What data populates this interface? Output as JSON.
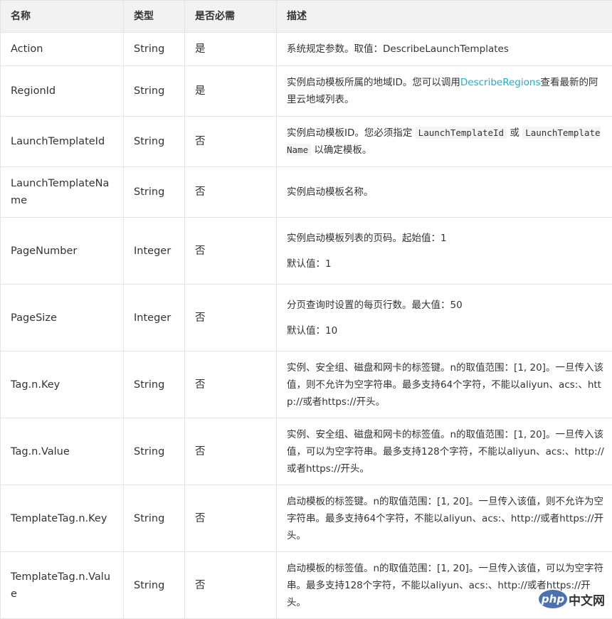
{
  "table": {
    "headers": [
      "名称",
      "类型",
      "是否必需",
      "描述"
    ],
    "rows": [
      {
        "name": "Action",
        "type": "String",
        "required": "是",
        "desc": "系统规定参数。取值：DescribeLaunchTemplates"
      },
      {
        "name": "RegionId",
        "type": "String",
        "required": "是",
        "desc_pre": "实例启动模板所属的地域ID。您可以调用",
        "desc_link": "DescribeRegions",
        "desc_post": "查看最新的阿里云地域列表。"
      },
      {
        "name": "LaunchTemplateId",
        "type": "String",
        "required": "否",
        "desc_pre": "实例启动模板ID。您必须指定 ",
        "code1": "LaunchTemplateId",
        "desc_mid": " 或 ",
        "code2": "LaunchTemplateName",
        "desc_post": " 以确定模板。"
      },
      {
        "name": "LaunchTemplateName",
        "type": "String",
        "required": "否",
        "desc": "实例启动模板名称。"
      },
      {
        "name": "PageNumber",
        "type": "Integer",
        "required": "否",
        "desc_lines": [
          "实例启动模板列表的页码。起始值：1",
          "默认值：1"
        ]
      },
      {
        "name": "PageSize",
        "type": "Integer",
        "required": "否",
        "desc_lines": [
          "分页查询时设置的每页行数。最大值：50",
          "默认值：10"
        ]
      },
      {
        "name": "Tag.n.Key",
        "type": "String",
        "required": "否",
        "desc": "实例、安全组、磁盘和网卡的标签键。n的取值范围：[1, 20]。一旦传入该值，则不允许为空字符串。最多支持64个字符，不能以aliyun、acs:、http://或者https://开头。"
      },
      {
        "name": "Tag.n.Value",
        "type": "String",
        "required": "否",
        "desc": "实例、安全组、磁盘和网卡的标签值。n的取值范围：[1, 20]。一旦传入该值，可以为空字符串。最多支持128个字符，不能以aliyun、acs:、http://或者https://开头。"
      },
      {
        "name": "TemplateTag.n.Key",
        "type": "String",
        "required": "否",
        "desc": "启动模板的标签键。n的取值范围：[1, 20]。一旦传入该值，则不允许为空字符串。最多支持64个字符，不能以aliyun、acs:、http://或者https://开头。"
      },
      {
        "name": "TemplateTag.n.Value",
        "type": "String",
        "required": "否",
        "desc": "启动模板的标签值。n的取值范围：[1, 20]。一旦传入该值，可以为空字符串。最多支持128个字符，不能以aliyun、acs:、http://或者https://开头。"
      }
    ]
  },
  "watermark": {
    "logo_text": "php",
    "site_text": "中文网"
  }
}
